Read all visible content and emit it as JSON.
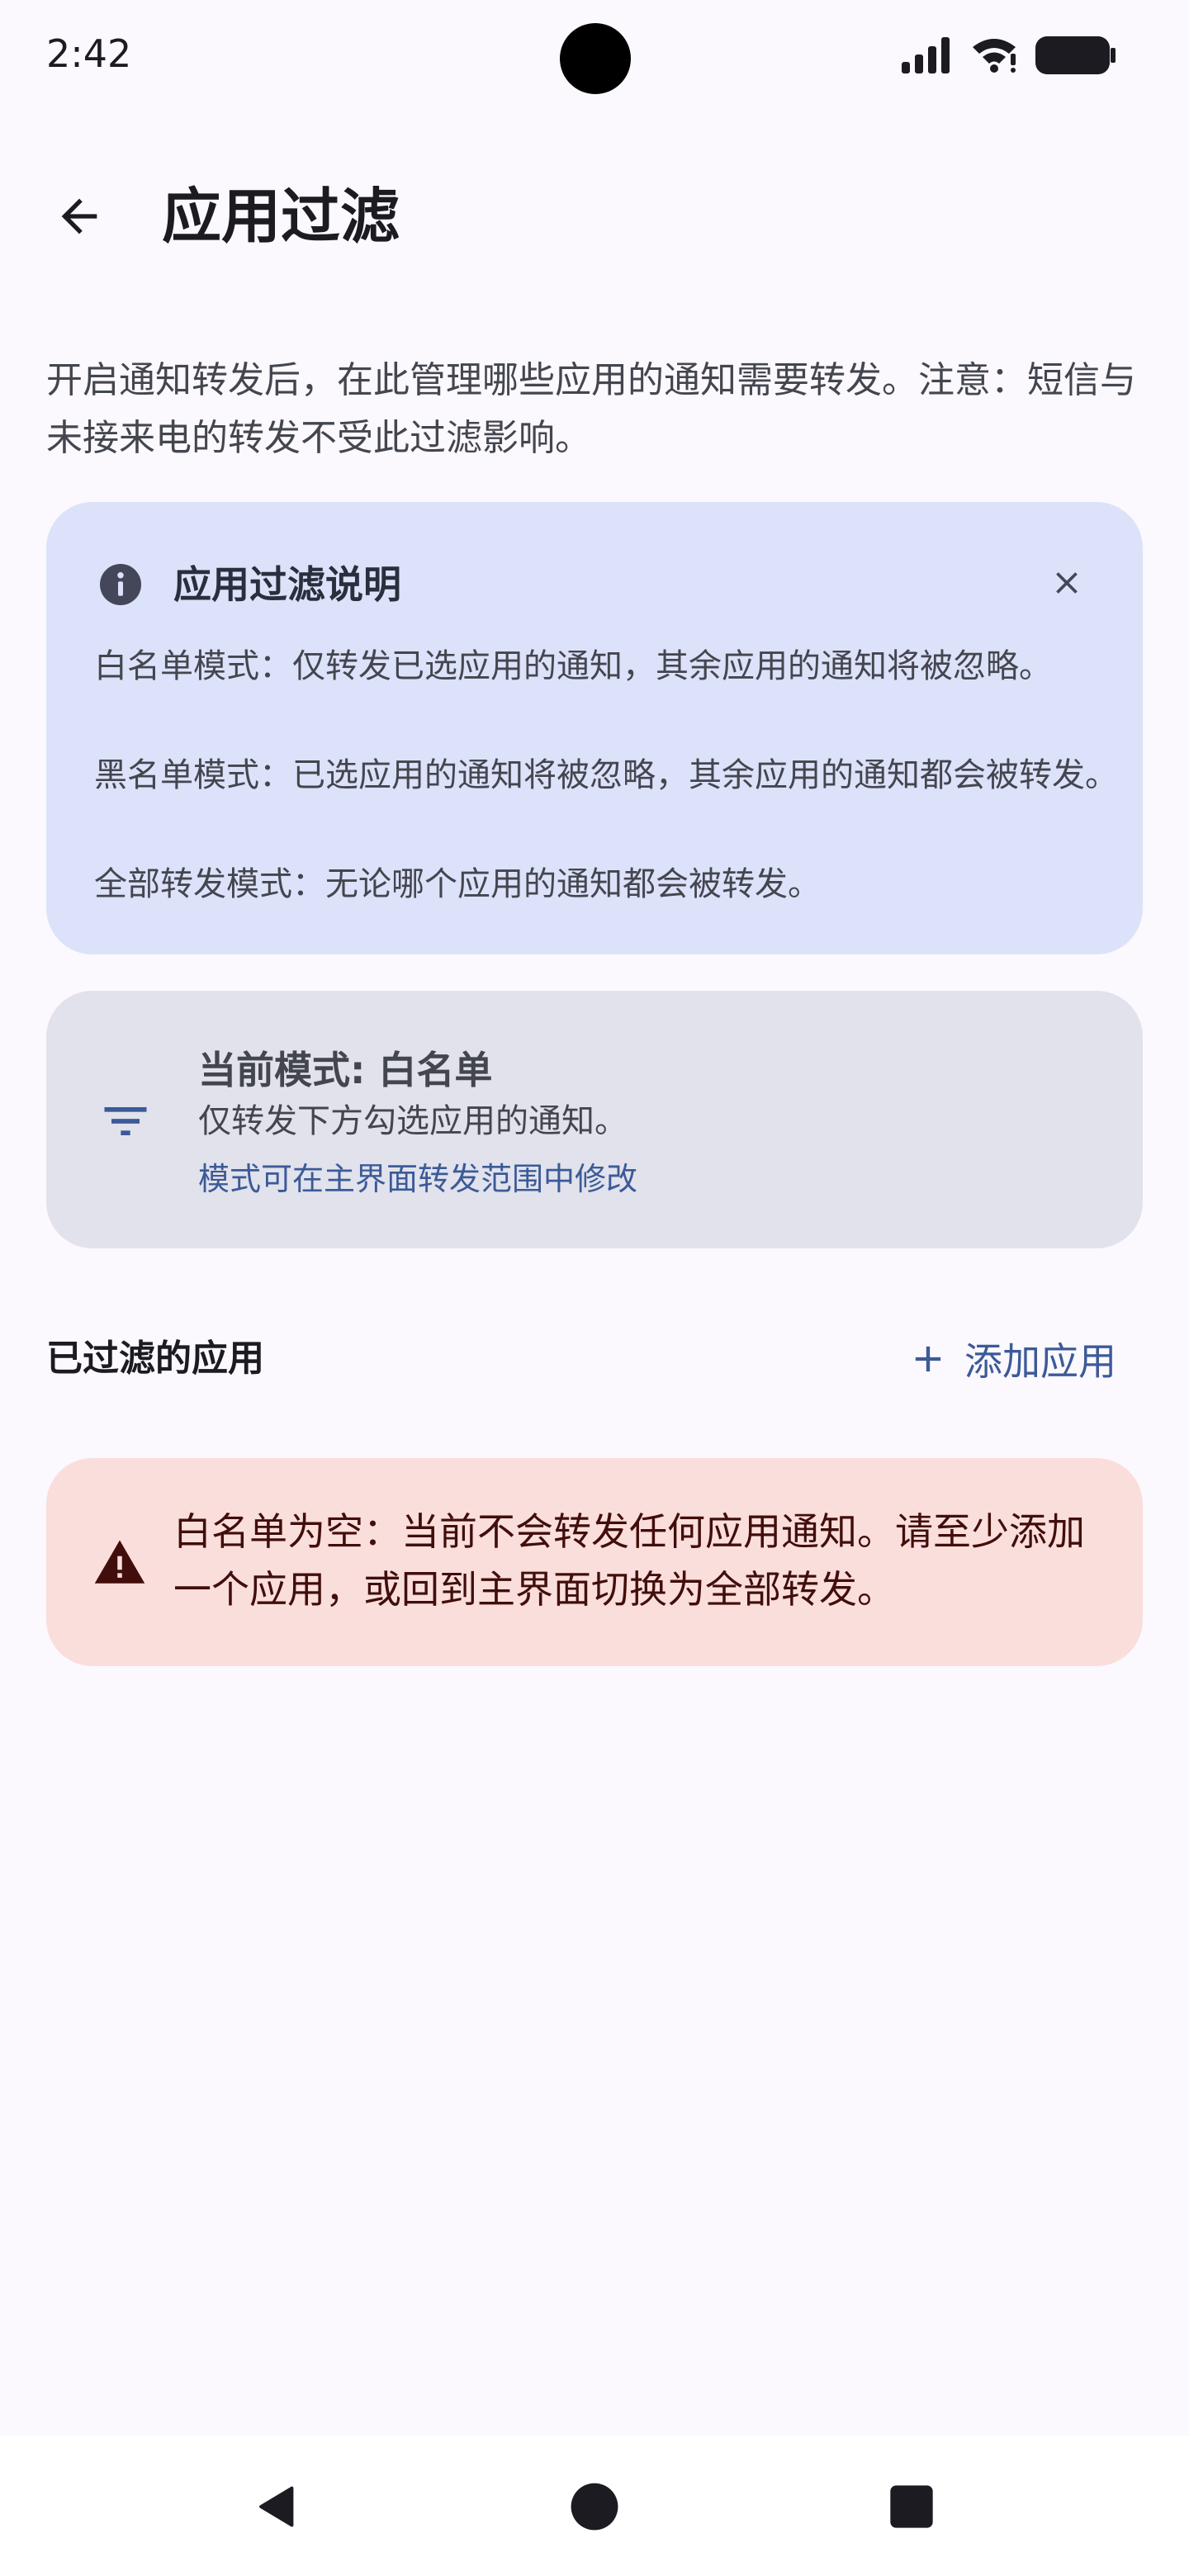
{
  "status_bar": {
    "time": "2:42",
    "icons": [
      "signal-icon",
      "wifi-icon",
      "battery-icon"
    ]
  },
  "header": {
    "back_icon": "arrow-left-icon",
    "title": "应用过滤"
  },
  "description": "开启通知转发后，在此管理哪些应用的通知需要转发。注意：短信与未接来电的转发不受此过滤影响。",
  "info_card": {
    "icon": "info-icon",
    "title": "应用过滤说明",
    "close_icon": "close-icon",
    "items": [
      "白名单模式：仅转发已选应用的通知，其余应用的通知将被忽略。",
      "黑名单模式：已选应用的通知将被忽略，其余应用的通知都会被转发。",
      "全部转发模式：无论哪个应用的通知都会被转发。"
    ]
  },
  "mode_card": {
    "icon": "filter-icon",
    "title": "当前模式: 白名单",
    "description": "仅转发下方勾选应用的通知。",
    "hint": "模式可在主界面转发范围中修改"
  },
  "filtered_apps": {
    "section_title": "已过滤的应用",
    "add_button_icon": "plus-icon",
    "add_button_label": "添加应用"
  },
  "warning_card": {
    "icon": "warning-icon",
    "text": "白名单为空：当前不会转发任何应用通知。请至少添加一个应用，或回到主界面切换为全部转发。"
  },
  "nav_bar": {
    "back_icon": "nav-back-icon",
    "home_icon": "nav-home-icon",
    "recents_icon": "nav-recents-icon"
  },
  "colors": {
    "background": "#fbf8fe",
    "info_card_bg": "#dce2f9",
    "mode_card_bg": "#e1e2ec",
    "warning_card_bg": "#fadedc",
    "accent": "#3c5a98",
    "warning_text": "#410e0b"
  }
}
